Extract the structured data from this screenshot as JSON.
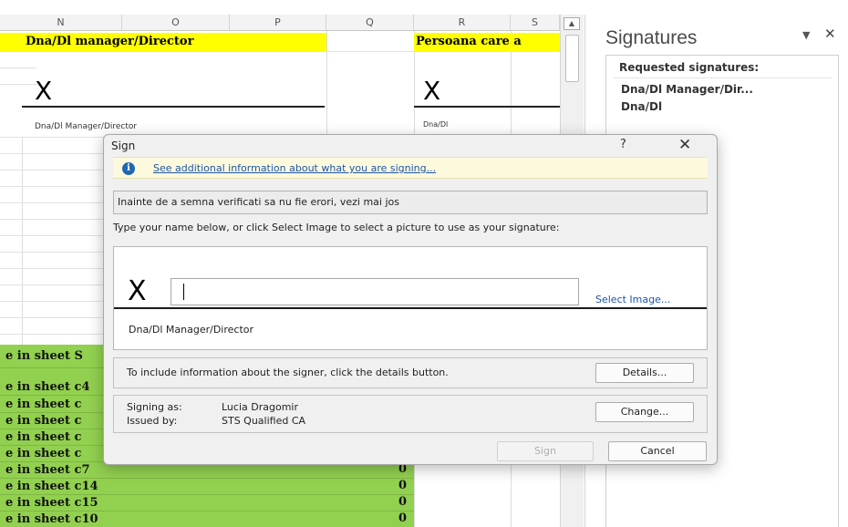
{
  "sheet": {
    "columns": [
      "N",
      "O",
      "P",
      "Q",
      "R",
      "S"
    ],
    "yellow_left": "Dna/Dl manager/Director",
    "yellow_right": "Persoana care a",
    "x_left": "X",
    "x_right": "X",
    "role_left": "Dna/Dl Manager/Director",
    "role_right": "Dna/Dl",
    "green_rows": [
      {
        "text": "e  in sheet S",
        "value": ""
      },
      {
        "text": "e in sheet c4",
        "value": ""
      },
      {
        "text": "e  in sheet  c",
        "value": ""
      },
      {
        "text": "e  in sheet  c",
        "value": ""
      },
      {
        "text": "e  in sheet  c",
        "value": ""
      },
      {
        "text": "e  in sheet  c",
        "value": ""
      },
      {
        "text": "e  in sheet  c7",
        "value": "0"
      },
      {
        "text": "e  in sheet  c14",
        "value": "0"
      },
      {
        "text": "e  in sheet  c15",
        "value": "0"
      },
      {
        "text": "e  in sheet  c10",
        "value": "0"
      }
    ]
  },
  "pane": {
    "title": "Signatures",
    "requested_label": "Requested signatures:",
    "items": [
      "Dna/Dl Manager/Dir...",
      "Dna/Dl"
    ]
  },
  "dialog": {
    "title": "Sign",
    "help": "?",
    "close": "✕",
    "info_link": "See additional information about what you are signing...",
    "purpose": "Inainte de a semna verificati sa nu fie erori, vezi mai jos",
    "instruction": "Type your name below, or click Select Image to select a picture to use as your signature:",
    "sig_x": "X",
    "name_value": "",
    "select_image": "Select Image...",
    "signer_role": "Dna/Dl Manager/Director",
    "details_text": "To include information about the signer, click the details button.",
    "details_button": "Details...",
    "signing_as_label": "Signing as:",
    "signing_as_value": "Lucia Dragomir",
    "issued_by_label": "Issued by:",
    "issued_by_value": "STS Qualified CA",
    "change_button": "Change...",
    "sign_button": "Sign",
    "cancel_button": "Cancel"
  }
}
